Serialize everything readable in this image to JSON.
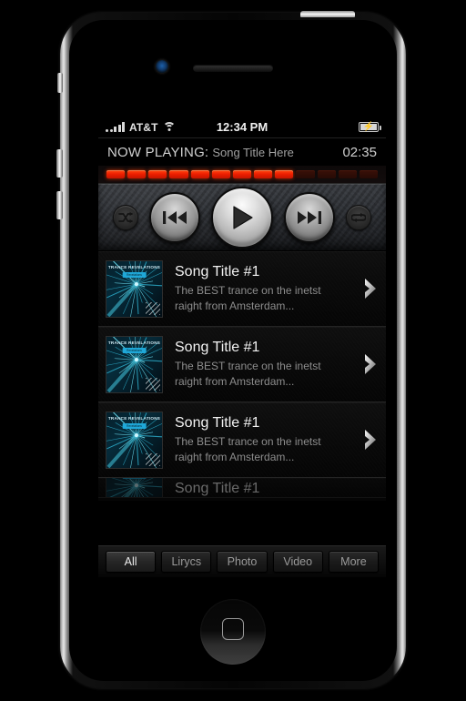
{
  "device": {
    "name": "iphone-4",
    "hardware": {
      "power_button": "power-button",
      "silent_switch": "silent-switch",
      "volume_up": "volume-up-button",
      "volume_down": "volume-down-button",
      "home_button": "home-button",
      "front_camera": "front-camera",
      "earpiece": "earpiece-speaker"
    }
  },
  "status_bar": {
    "carrier": "AT&T",
    "time": "12:34 PM",
    "signal_icon": "signal-bars-icon",
    "wifi_icon": "wifi-icon",
    "battery_icon": "battery-charging-icon",
    "battery_bolt": "⚡"
  },
  "now_playing": {
    "label": "NOW PLAYING:",
    "title": "Song Title Here",
    "time": "02:35",
    "progress": {
      "segments_total": 13,
      "segments_lit": 9,
      "lit_color": "#ef2000",
      "unlit_color": "#2b0c06"
    }
  },
  "transport": {
    "shuffle": {
      "label": "Shuffle",
      "icon": "shuffle-icon"
    },
    "previous": {
      "label": "Previous",
      "icon": "previous-track-icon"
    },
    "play": {
      "label": "Play",
      "icon": "play-icon"
    },
    "next": {
      "label": "Next",
      "icon": "next-track-icon"
    },
    "repeat": {
      "label": "Repeat",
      "icon": "repeat-icon"
    }
  },
  "song_list": {
    "album_art": {
      "title": "TRANCE REVELATIONS",
      "badge": "Revelations",
      "accent_color": "#1fa8d8"
    },
    "rows": [
      {
        "title": "Song Title #1",
        "desc_line1": "The BEST trance on the inetst",
        "desc_line2": "raight from Amsterdam...",
        "chevron": "chevron-right-icon"
      },
      {
        "title": "Song Title #1",
        "desc_line1": "The BEST trance on the inetst",
        "desc_line2": "raight from Amsterdam...",
        "chevron": "chevron-right-icon"
      },
      {
        "title": "Song Title #1",
        "desc_line1": "The BEST trance on the inetst",
        "desc_line2": "raight from Amsterdam...",
        "chevron": "chevron-right-icon"
      }
    ],
    "partial_row": {
      "title": "Song Title #1"
    }
  },
  "tab_bar": {
    "tabs": [
      {
        "label": "All",
        "active": true
      },
      {
        "label": "Lirycs",
        "active": false
      },
      {
        "label": "Photo",
        "active": false
      },
      {
        "label": "Video",
        "active": false
      },
      {
        "label": "More",
        "active": false
      }
    ]
  }
}
